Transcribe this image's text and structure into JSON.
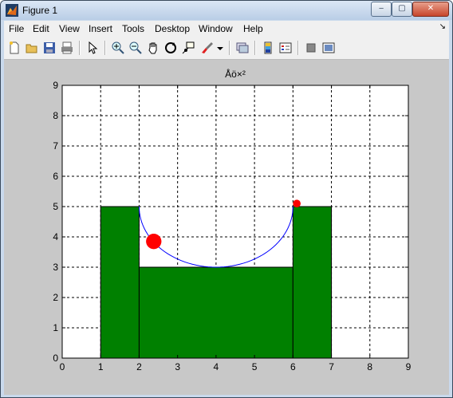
{
  "window": {
    "title": "Figure 1"
  },
  "controls": {
    "minimize": "‒",
    "maximize": "▢",
    "close": "✕"
  },
  "menu": {
    "items": [
      "File",
      "Edit",
      "View",
      "Insert",
      "Tools",
      "Desktop",
      "Window",
      "Help"
    ],
    "overflow_arrow": "↘"
  },
  "toolbar": {
    "icons": [
      "new-figure-icon",
      "open-file-icon",
      "save-icon",
      "print-icon",
      "edit-plot-arrow-icon",
      "zoom-in-icon",
      "zoom-out-icon",
      "pan-hand-icon",
      "rotate-3d-icon",
      "data-cursor-icon",
      "brush-icon",
      "brush-dropdown-icon",
      "link-plot-icon",
      "insert-colorbar-icon",
      "insert-legend-icon",
      "hide-plot-tools-icon",
      "show-plot-tools-icon"
    ]
  },
  "chart_data": {
    "type": "area",
    "title": "Åö×²",
    "xlabel": "",
    "ylabel": "",
    "xlim": [
      0,
      9
    ],
    "ylim": [
      0,
      9
    ],
    "xticks": [
      "0",
      "1",
      "2",
      "3",
      "4",
      "5",
      "6",
      "7",
      "8",
      "9"
    ],
    "yticks": [
      "0",
      "1",
      "2",
      "3",
      "4",
      "5",
      "6",
      "7",
      "8",
      "9"
    ],
    "grid": true,
    "colors": {
      "fill": "#008000",
      "curve": "#0000ff",
      "ball": "#ff0000"
    },
    "rectangles": [
      {
        "x0": 1,
        "x1": 2,
        "y0": 0,
        "y1": 5
      },
      {
        "x0": 2,
        "x1": 6,
        "y0": 0,
        "y1": 3
      },
      {
        "x0": 6,
        "x1": 7,
        "y0": 0,
        "y1": 5
      }
    ],
    "curve": {
      "type": "semi-ellipse",
      "center_x": 4,
      "center_y": 5,
      "radius_x": 2,
      "radius_y": 2
    },
    "balls": [
      {
        "x": 2.38,
        "y": 3.85,
        "radius": 0.2
      },
      {
        "x": 6.1,
        "y": 5.1,
        "radius": 0.1
      }
    ]
  }
}
